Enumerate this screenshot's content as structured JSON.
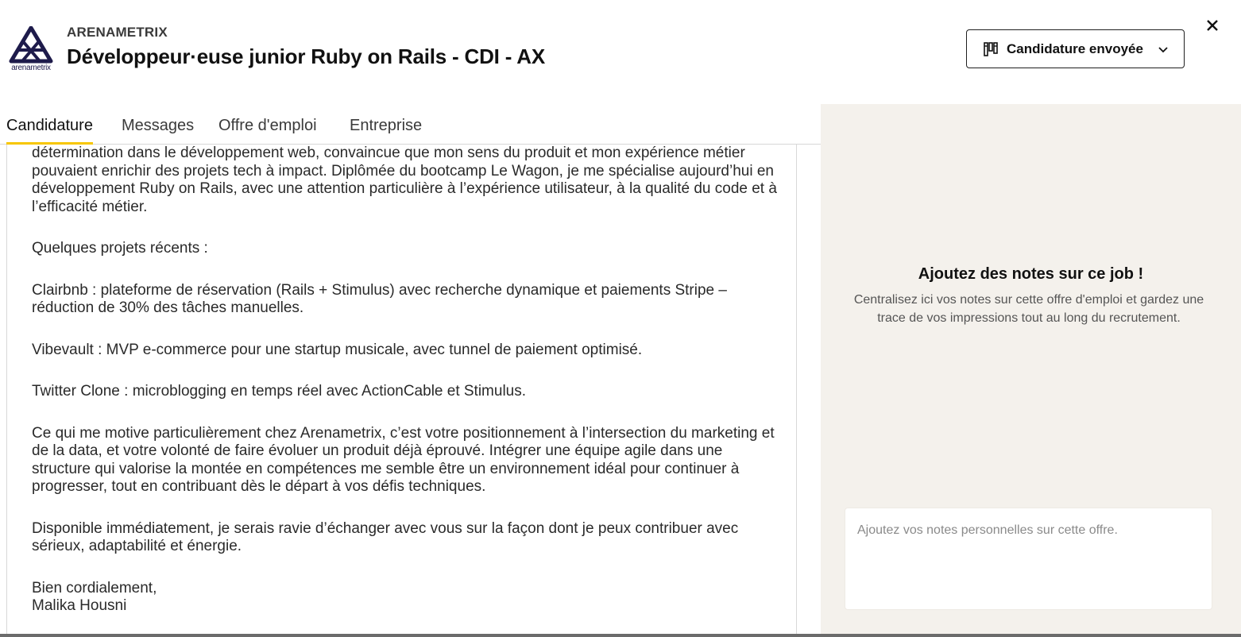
{
  "header": {
    "logo_text": "arenametrix",
    "company": "ARENAMETRIX",
    "job_title": "Développeur·euse junior Ruby on Rails - CDI - AX",
    "status_label": "Candidature envoyée",
    "status_icon": "kanban-icon",
    "close_icon": "close-icon"
  },
  "tabs": [
    {
      "label": "Candidature",
      "active": true
    },
    {
      "label": "Messages",
      "active": false
    },
    {
      "label": "Offre d'emploi",
      "active": false
    },
    {
      "label": "Entreprise",
      "active": false
    }
  ],
  "letter": {
    "paragraphs": [
      "détermination dans le développement web, convaincue que mon sens du produit et mon expérience métier pouvaient enrichir des projets tech à impact. Diplômée du bootcamp Le Wagon, je me spécialise aujourd’hui en développement Ruby on Rails, avec une attention particulière à l’expérience utilisateur, à la qualité du code et à l’efficacité métier.",
      "Quelques projets récents :",
      "Clairbnb : plateforme de réservation (Rails + Stimulus) avec recherche dynamique et paiements Stripe – réduction de 30% des tâches manuelles.",
      "Vibevault : MVP e-commerce pour une startup musicale, avec tunnel de paiement optimisé.",
      "Twitter Clone : microblogging en temps réel avec ActionCable et Stimulus.",
      "Ce qui me motive particulièrement chez Arenametrix, c’est votre positionnement à l’intersection du marketing et de la data, et votre volonté de faire évoluer un produit déjà éprouvé. Intégrer une équipe agile dans une structure qui valorise la montée en compétences me semble être un environnement idéal pour continuer à progresser, tout en contribuant dès le départ à vos défis techniques.",
      "Disponible immédiatement, je serais ravie d’échanger avec vous sur la façon dont je peux contribuer avec sérieux, adaptabilité et énergie."
    ],
    "closing": "Bien cordialement,",
    "signature": "Malika Housni"
  },
  "notes": {
    "title": "Ajoutez des notes sur ce job !",
    "description": "Centralisez ici vos notes sur cette offre d'emploi et gardez une trace de vos impressions tout au long du recrutement.",
    "placeholder": "Ajoutez vos notes personnelles sur cette offre.",
    "value": ""
  },
  "colors": {
    "accent": "#f7c600",
    "panel_bg": "#f4f1ec",
    "logo": "#1e1b4b"
  }
}
